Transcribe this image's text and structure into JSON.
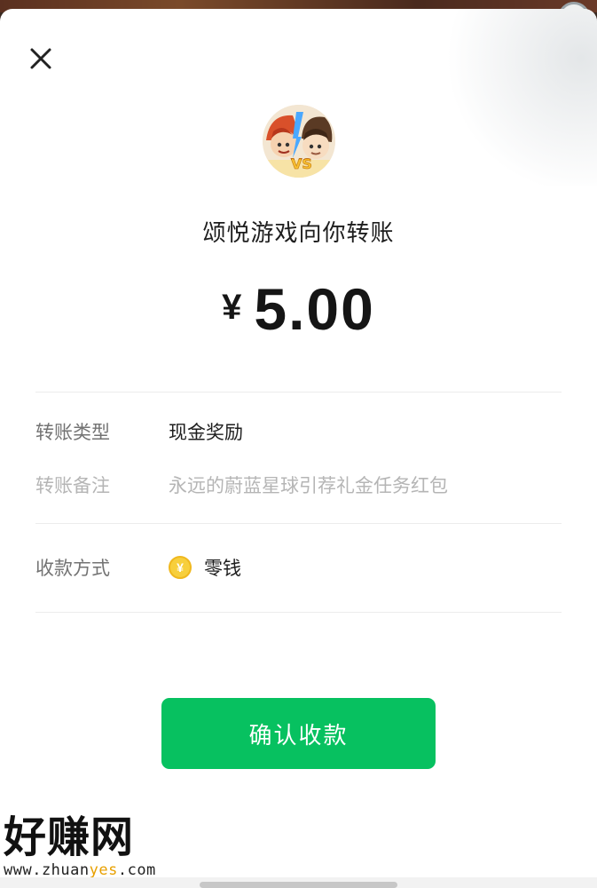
{
  "header": {
    "close_icon": "close-icon",
    "payer_text": "颂悦游戏向你转账"
  },
  "amount": {
    "currency_symbol": "¥",
    "value": "5.00"
  },
  "details": {
    "transfer_type": {
      "label": "转账类型",
      "value": "现金奖励"
    },
    "transfer_note": {
      "label": "转账备注",
      "value": "永远的蔚蓝星球引荐礼金任务红包"
    },
    "receive_method": {
      "label": "收款方式",
      "value": "零钱",
      "icon": "coin-icon",
      "icon_glyph": "¥"
    }
  },
  "actions": {
    "confirm_label": "确认收款"
  },
  "watermark": {
    "title": "好赚网",
    "url_prefix": "www.zhuan",
    "url_highlight": "yes",
    "url_suffix": ".com"
  },
  "colors": {
    "accent": "#07c160",
    "coin": "#f7cf3c"
  }
}
